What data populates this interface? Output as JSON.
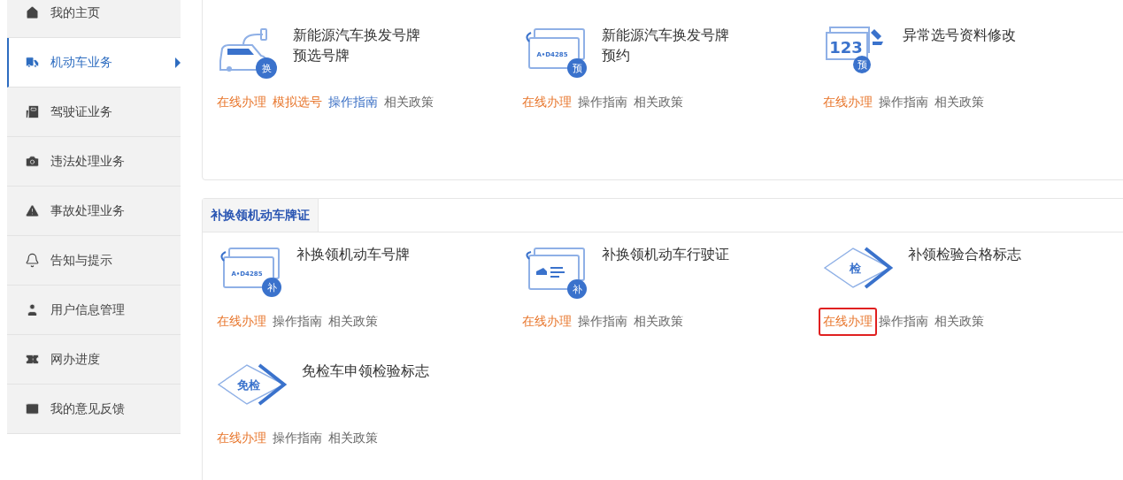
{
  "sidebar": {
    "items": [
      {
        "label": "我的主页",
        "selected": false
      },
      {
        "label": "机动车业务",
        "selected": true
      },
      {
        "label": "驾驶证业务",
        "selected": false
      },
      {
        "label": "违法处理业务",
        "selected": false
      },
      {
        "label": "事故处理业务",
        "selected": false
      },
      {
        "label": "告知与提示",
        "selected": false
      },
      {
        "label": "用户信息管理",
        "selected": false
      },
      {
        "label": "网办进度",
        "selected": false
      },
      {
        "label": "我的意见反馈",
        "selected": false
      }
    ]
  },
  "sections": [
    {
      "items": [
        {
          "title": [
            "新能源汽车换发号牌",
            "预选号牌"
          ],
          "icon": {
            "kind": "car",
            "badge": "换"
          },
          "links": [
            {
              "label": "在线办理",
              "color": "#e8762c",
              "highlighted": false
            },
            {
              "label": "模拟选号",
              "color": "#e8762c",
              "highlighted": false
            },
            {
              "label": "操作指南",
              "color": "#3a6fc4",
              "highlighted": false
            },
            {
              "label": "相关政策",
              "color": "#666666",
              "highlighted": false
            }
          ]
        },
        {
          "title": [
            "新能源汽车换发号牌",
            "预约"
          ],
          "icon": {
            "kind": "plate",
            "plate": "A•D4285",
            "badge": "预"
          },
          "links": [
            {
              "label": "在线办理",
              "color": "#e8762c",
              "highlighted": false
            },
            {
              "label": "操作指南",
              "color": "#666666",
              "highlighted": false
            },
            {
              "label": "相关政策",
              "color": "#666666",
              "highlighted": false
            }
          ]
        },
        {
          "title": [
            "异常选号资料修改"
          ],
          "icon": {
            "kind": "number",
            "number": "123",
            "badge": "预"
          },
          "links": [
            {
              "label": "在线办理",
              "color": "#e8762c",
              "highlighted": false
            },
            {
              "label": "操作指南",
              "color": "#666666",
              "highlighted": false
            },
            {
              "label": "相关政策",
              "color": "#666666",
              "highlighted": false
            }
          ]
        }
      ]
    },
    {
      "tab": "补换领机动车牌证",
      "items": [
        {
          "title": [
            "补换领机动车号牌"
          ],
          "icon": {
            "kind": "plate",
            "plate": "A•D4285",
            "badge": "补"
          },
          "links": [
            {
              "label": "在线办理",
              "color": "#e8762c",
              "highlighted": false
            },
            {
              "label": "操作指南",
              "color": "#666666",
              "highlighted": false
            },
            {
              "label": "相关政策",
              "color": "#666666",
              "highlighted": false
            }
          ]
        },
        {
          "title": [
            "补换领机动车行驶证"
          ],
          "icon": {
            "kind": "license",
            "badge": "补"
          },
          "links": [
            {
              "label": "在线办理",
              "color": "#e8762c",
              "highlighted": false
            },
            {
              "label": "操作指南",
              "color": "#666666",
              "highlighted": false
            },
            {
              "label": "相关政策",
              "color": "#666666",
              "highlighted": false
            }
          ]
        },
        {
          "title": [
            "补领检验合格标志"
          ],
          "icon": {
            "kind": "diamond",
            "label": "检"
          },
          "links": [
            {
              "label": "在线办理",
              "color": "#e8762c",
              "highlighted": true
            },
            {
              "label": "操作指南",
              "color": "#666666",
              "highlighted": false
            },
            {
              "label": "相关政策",
              "color": "#666666",
              "highlighted": false
            }
          ]
        },
        {
          "title": [
            "免检车申领检验标志"
          ],
          "icon": {
            "kind": "diamond",
            "label": "免检"
          },
          "links": [
            {
              "label": "在线办理",
              "color": "#e8762c",
              "highlighted": false
            },
            {
              "label": "操作指南",
              "color": "#666666",
              "highlighted": false
            },
            {
              "label": "相关政策",
              "color": "#666666",
              "highlighted": false
            }
          ]
        }
      ]
    }
  ]
}
